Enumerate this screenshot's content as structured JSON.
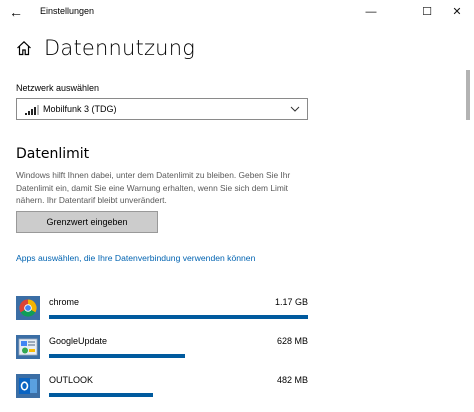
{
  "window": {
    "title": "Einstellungen",
    "minimize_glyph": "—",
    "maximize_glyph": "☐",
    "close_glyph": "✕",
    "back_glyph": "←"
  },
  "page": {
    "title": "Datennutzung"
  },
  "network": {
    "label": "Netzwerk auswählen",
    "selected": "Mobilfunk 3 (TDG)",
    "icon": "signal-bars-icon"
  },
  "datalimit": {
    "title": "Datenlimit",
    "description": "Windows hilft Ihnen dabei, unter dem Datenlimit zu bleiben. Geben Sie Ihr Datenlimit ein, damit Sie eine Warnung erhalten, wenn Sie sich dem Limit nähern. Ihr Datentarif bleibt unverändert.",
    "button_label": "Grenzwert eingeben"
  },
  "apps_link": "Apps auswählen, die Ihre Datenverbindung verwenden können",
  "apps": [
    {
      "name": "chrome",
      "size": "1.17 GB",
      "fraction": 1.0,
      "icon": "chrome-icon"
    },
    {
      "name": "GoogleUpdate",
      "size": "628 MB",
      "fraction": 0.524,
      "icon": "google-update-icon"
    },
    {
      "name": "OUTLOOK",
      "size": "482 MB",
      "fraction": 0.402,
      "icon": "outlook-icon"
    }
  ],
  "colors": {
    "accent": "#005a9e",
    "link": "#0063b1"
  }
}
